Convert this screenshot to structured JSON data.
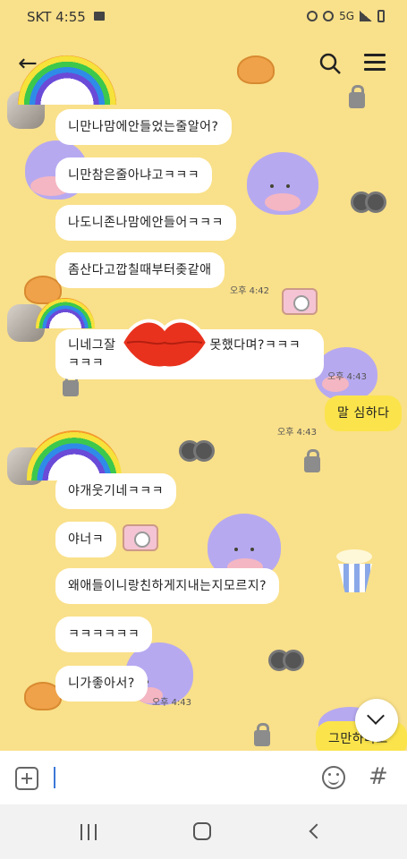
{
  "status_bar": {
    "carrier": "SKT 4:55",
    "network": "5G"
  },
  "messages": [
    {
      "side": "left",
      "text": "니만나맘에안들었는줄알어?"
    },
    {
      "side": "left",
      "text": "니만참은줄아냐고ㅋㅋㅋ"
    },
    {
      "side": "left",
      "text": "나도니존나맘에안들어ㅋㅋㅋ"
    },
    {
      "side": "left",
      "text": "좀산다고깝칠때부터좆같애",
      "time": "오후 4:42"
    },
    {
      "side": "left",
      "text_line1": "니네그잘",
      "text_line1_end": "못했다며?ㅋㅋㅋ",
      "text_line2": "ㅋㅋㅋ",
      "time": "오후 4:43"
    },
    {
      "side": "right",
      "text": "말 심하다",
      "time": "오후 4:43"
    },
    {
      "side": "left",
      "text": "야개웃기네ㅋㅋㅋ"
    },
    {
      "side": "left",
      "text": "야너ㅋ"
    },
    {
      "side": "left",
      "text": "왜애들이니랑친하게지내는지모르지?"
    },
    {
      "side": "left",
      "text": "ㅋㅋㅋㅋㅋㅋ"
    },
    {
      "side": "left",
      "text": "니가좋아서?",
      "time": "오후 4:43"
    },
    {
      "side": "right",
      "text": "그만하라고"
    }
  ],
  "input": {
    "placeholder": ""
  },
  "icons": [
    "back-arrow-icon",
    "search-icon",
    "menu-icon",
    "plus-icon",
    "emoji-icon",
    "hash-icon",
    "chevron-down-icon",
    "recent-apps-icon",
    "home-icon",
    "nav-back-icon"
  ],
  "colors": {
    "background": "#f9e08a",
    "my_bubble": "#fbe44b",
    "their_bubble": "#ffffff"
  }
}
